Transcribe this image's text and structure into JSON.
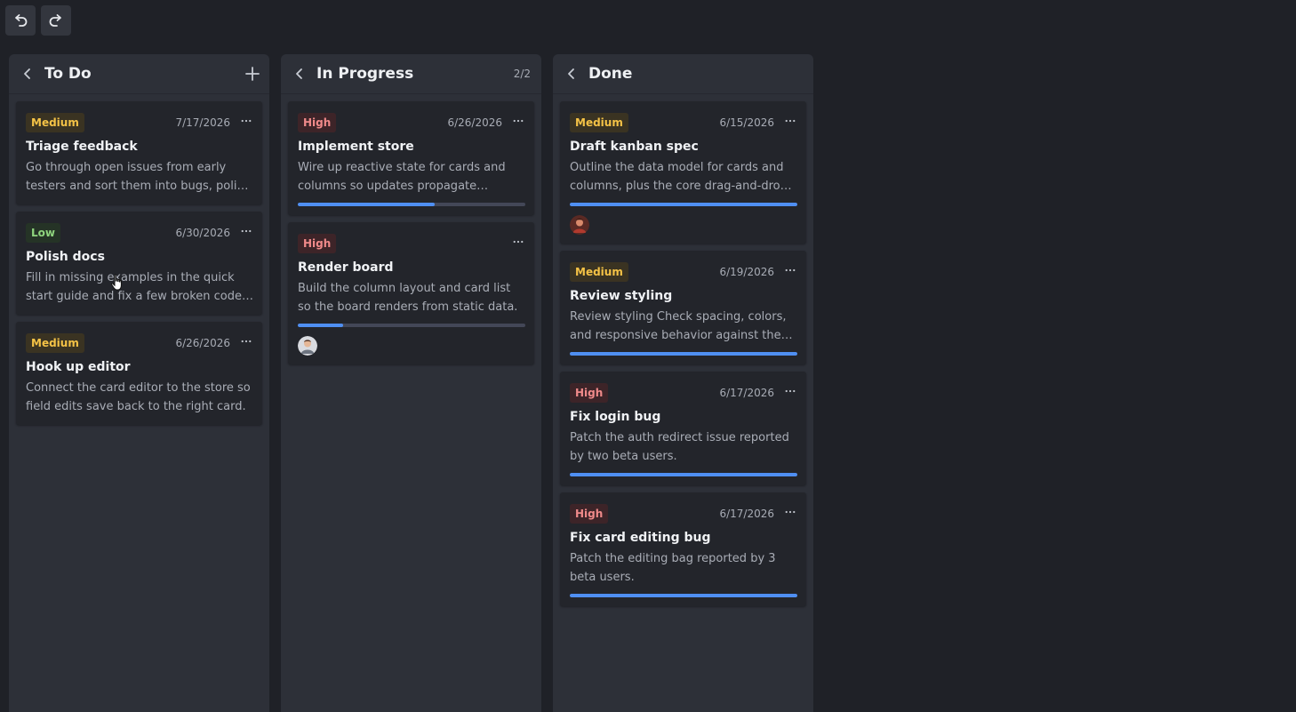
{
  "toolbar": {
    "undo_icon": "undo-icon",
    "redo_icon": "redo-icon"
  },
  "columns": [
    {
      "title": "To Do",
      "count": "",
      "cards": [
        {
          "priority": "Medium",
          "level": "medium",
          "date": "7/17/2026",
          "title": "Triage feedback",
          "desc": "Go through open issues from early testers and sort them into bugs, polish items, and feature requests.",
          "progress": null,
          "avatar": null
        },
        {
          "priority": "Low",
          "level": "low",
          "date": "6/30/2026",
          "title": "Polish docs",
          "desc": "Fill in missing examples in the quick start guide and fix a few broken code samples.",
          "progress": null,
          "avatar": null
        },
        {
          "priority": "Medium",
          "level": "medium",
          "date": "6/26/2026",
          "title": "Hook up editor",
          "desc": "Connect the card editor to the store so field edits save back to the right card.",
          "progress": null,
          "avatar": null
        }
      ]
    },
    {
      "title": "In Progress",
      "count": "2/2",
      "cards": [
        {
          "priority": "High",
          "level": "high",
          "date": "6/26/2026",
          "title": "Implement store",
          "desc": "Wire up reactive state for cards and columns so updates propagate throughout the board.",
          "progress": 0.6,
          "avatar": null
        },
        {
          "priority": "High",
          "level": "high",
          "date": "",
          "title": "Render board",
          "desc": "Build the column layout and card list so the board renders from static data.",
          "progress": 0.2,
          "avatar": "avatar-b"
        }
      ]
    },
    {
      "title": "Done",
      "count": "",
      "cards": [
        {
          "priority": "Medium",
          "level": "medium",
          "date": "6/15/2026",
          "title": "Draft kanban spec",
          "desc": "Outline the data model for cards and columns, plus the core drag-and-drop interactions.",
          "progress": 1.0,
          "avatar": "avatar-a"
        },
        {
          "priority": "Medium",
          "level": "medium",
          "date": "6/19/2026",
          "title": "Review styling",
          "desc": "Review styling Check spacing, colors, and responsive behavior against the design mockups.",
          "progress": 1.0,
          "avatar": null
        },
        {
          "priority": "High",
          "level": "high",
          "date": "6/17/2026",
          "title": "Fix login bug",
          "desc": "Patch the auth redirect issue reported by two beta users.",
          "progress": 1.0,
          "avatar": null
        },
        {
          "priority": "High",
          "level": "high",
          "date": "6/17/2026",
          "title": "Fix card editing bug",
          "desc": "Patch the editing bag reported by 3 beta users.",
          "progress": 1.0,
          "avatar": null
        }
      ]
    }
  ],
  "colors": {
    "accent": "#4f8ff2",
    "track": "#434757",
    "medium": "#f4c246",
    "low": "#8fd47e",
    "high": "#f08a8a"
  }
}
